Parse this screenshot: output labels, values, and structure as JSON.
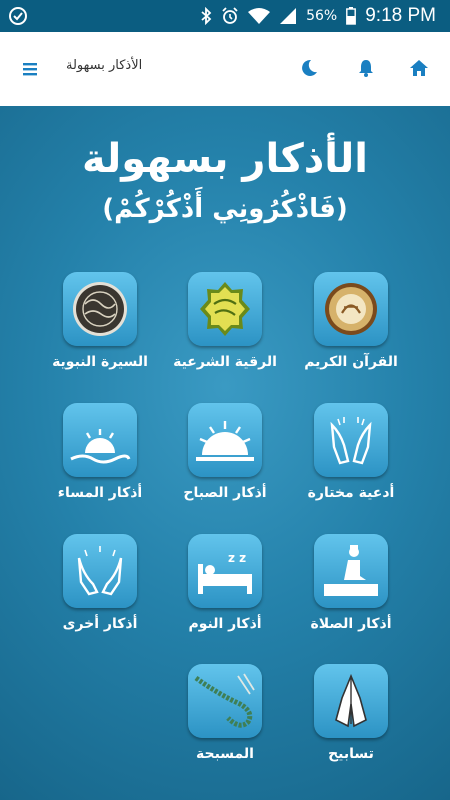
{
  "status_bar": {
    "time": "9:18 PM",
    "battery": "56%",
    "icons": [
      "check-circle-icon",
      "bluetooth-icon",
      "alarm-icon",
      "wifi-icon",
      "signal-icon",
      "battery-icon"
    ]
  },
  "app_bar": {
    "title": "الأذكار بسهولة",
    "icons": [
      "menu-icon",
      "moon-icon",
      "bell-icon",
      "home-icon"
    ]
  },
  "hero": {
    "title": "الأذكار بسهولة",
    "subtitle": "(فَاذْكُرُونِي أَذْكُرْكُمْ)"
  },
  "tiles": [
    {
      "label": "القرآن الكريم",
      "icon": "quran-icon"
    },
    {
      "label": "الرقية الشرعية",
      "icon": "ruqyah-icon"
    },
    {
      "label": "السيرة النبوية",
      "icon": "seerah-seal-icon"
    },
    {
      "label": "أدعية مختارة",
      "icon": "praying-hands-icon"
    },
    {
      "label": "أذكار الصباح",
      "icon": "sunrise-icon"
    },
    {
      "label": "أذكار المساء",
      "icon": "sunset-icon"
    },
    {
      "label": "أذكار الصلاة",
      "icon": "prayer-mat-icon"
    },
    {
      "label": "أذكار النوم",
      "icon": "sleep-bed-icon"
    },
    {
      "label": "أذكار أخرى",
      "icon": "open-hands-icon"
    },
    {
      "label": "تسابيح",
      "icon": "namaste-hands-icon"
    },
    {
      "label": "المسبحة",
      "icon": "prayer-beads-icon"
    }
  ],
  "colors": {
    "status_bar": "#0b5d81",
    "background": "#1d6e92",
    "accent": "#1a7fc1",
    "tile": "#4fb4e0"
  }
}
